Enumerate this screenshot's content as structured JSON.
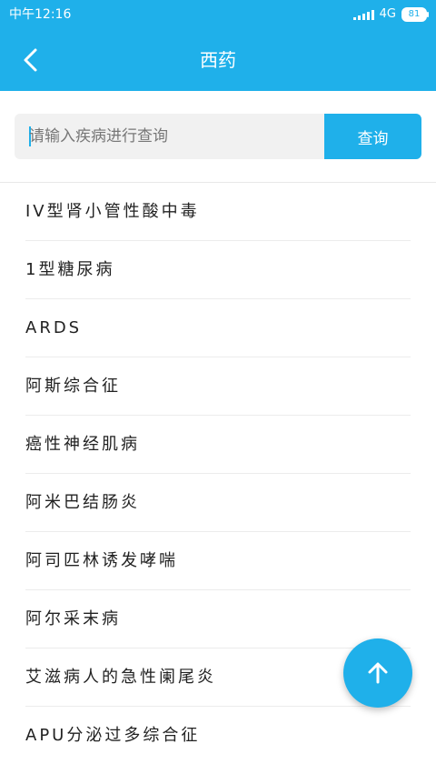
{
  "status_bar": {
    "time": "中午12:16",
    "network": "4G",
    "battery": "81"
  },
  "header": {
    "title": "西药",
    "back_icon": "back-arrow-icon"
  },
  "search": {
    "placeholder": "请输入疾病进行查询",
    "value": "",
    "button_label": "查询"
  },
  "diseases": [
    "IV型肾小管性酸中毒",
    "1型糖尿病",
    "ARDS",
    "阿斯综合征",
    "癌性神经肌病",
    "阿米巴结肠炎",
    "阿司匹林诱发哮喘",
    "阿尔采末病",
    "艾滋病人的急性阑尾炎",
    "APU分泌过多综合征"
  ],
  "fab": {
    "icon": "arrow-up-icon"
  },
  "colors": {
    "primary": "#1fb0ea",
    "search_bg": "#f1f1f1",
    "divider": "#ececec"
  }
}
